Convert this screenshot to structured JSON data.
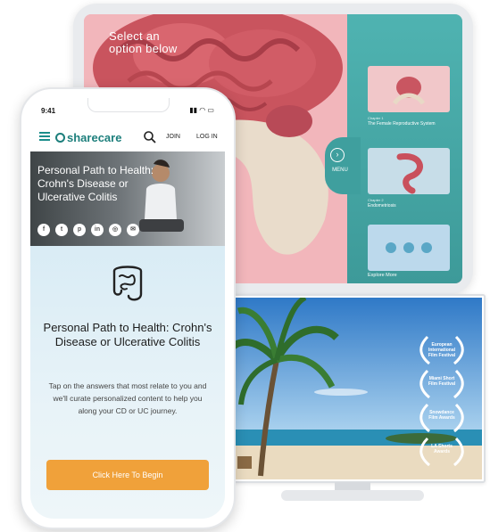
{
  "tablet": {
    "panel_title": "Select an option below",
    "menu_label": "MENU",
    "options": [
      {
        "chapter": "Chapter 1",
        "name": "The Female Reproductive System"
      },
      {
        "chapter": "Chapter 2",
        "name": "Endometriosis"
      }
    ],
    "explore_label": "Explore More"
  },
  "monitor": {
    "laurels": [
      {
        "text": "European International Film Festival"
      },
      {
        "text": "Miami Short Film Festival"
      },
      {
        "text": "Snowdance Film Awards"
      },
      {
        "text": "LA Shorts Awards"
      }
    ]
  },
  "phone": {
    "status_time": "9:41",
    "logo_text": "sharecare",
    "nav": {
      "join": "JOIN",
      "login": "LOG IN"
    },
    "hero_title": "Personal Path to Health: Crohn's Disease or Ulcerative Colitis",
    "social_icons": [
      "facebook-icon",
      "twitter-icon",
      "pinterest-icon",
      "linkedin-icon",
      "instagram-icon",
      "email-icon"
    ],
    "content_title": "Personal Path to Health: Crohn's Disease or Ulcerative Colitis",
    "content_desc": "Tap on the answers that most relate to you and we'll curate personalized content to help you along your CD or UC journey.",
    "cta_label": "Click Here To Begin"
  },
  "colors": {
    "teal": "#3d9a99",
    "cta_orange": "#f0a13a",
    "brand": "#1d7f7c"
  }
}
